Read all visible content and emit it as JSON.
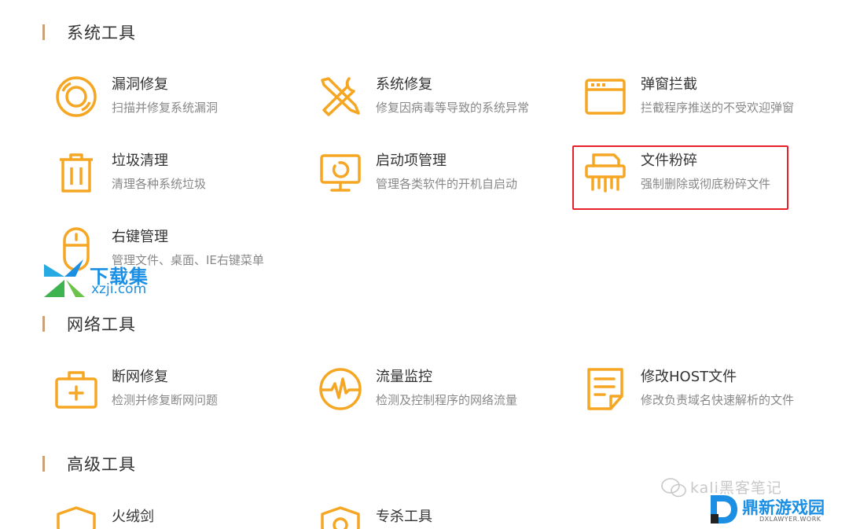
{
  "sections": {
    "system": {
      "title": "系统工具",
      "tools": [
        {
          "name": "漏洞修复",
          "desc": "扫描并修复系统漏洞",
          "icon": "lifebuoy-icon"
        },
        {
          "name": "系统修复",
          "desc": "修复因病毒等导致的系统异常",
          "icon": "wrench-screwdriver-icon"
        },
        {
          "name": "弹窗拦截",
          "desc": "拦截程序推送的不受欢迎弹窗",
          "icon": "popup-window-icon"
        },
        {
          "name": "垃圾清理",
          "desc": "清理各种系统垃圾",
          "icon": "trash-icon"
        },
        {
          "name": "启动项管理",
          "desc": "管理各类软件的开机自启动",
          "icon": "monitor-icon"
        },
        {
          "name": "文件粉碎",
          "desc": "强制删除或彻底粉碎文件",
          "icon": "shredder-icon"
        },
        {
          "name": "右键管理",
          "desc": "管理文件、桌面、IE右键菜单",
          "icon": "mouse-icon"
        }
      ]
    },
    "network": {
      "title": "网络工具",
      "tools": [
        {
          "name": "断网修复",
          "desc": "检测并修复断网问题",
          "icon": "medkit-icon"
        },
        {
          "name": "流量监控",
          "desc": "检测及控制程序的网络流量",
          "icon": "pulse-gauge-icon"
        },
        {
          "name": "修改HOST文件",
          "desc": "修改负责域名快速解析的文件",
          "icon": "document-edit-icon"
        }
      ]
    },
    "advanced": {
      "title": "高级工具",
      "tools": [
        {
          "name": "火绒剑",
          "icon": "shield-icon"
        },
        {
          "name": "专杀工具",
          "icon": "shield-icon"
        }
      ]
    }
  },
  "watermarks": {
    "xzji": {
      "brand": "下载集",
      "site": "xzji.com"
    },
    "dxlawyer": {
      "chat_text": "kali黑客笔记",
      "logo_name": "鼎新游戏园",
      "logo_sub": "DXLAWYER.WORK"
    }
  },
  "colors": {
    "accent": "#f5a623",
    "highlight": "#e8202a",
    "section_bar": "#c9a27a"
  }
}
